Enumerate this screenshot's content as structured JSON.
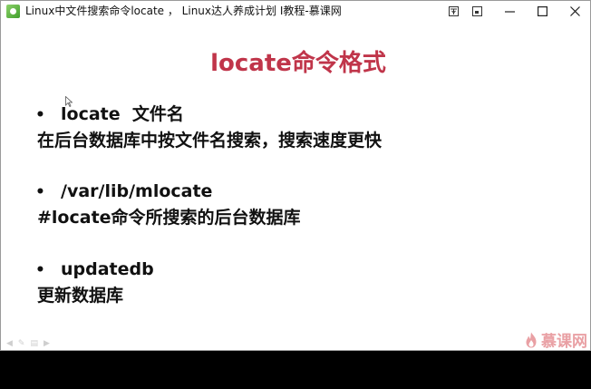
{
  "window": {
    "title": "Linux中文件搜索命令locate ， Linux达人养成计划 I教程-慕课网",
    "app_icon": "imooc-app-icon"
  },
  "titlebar_buttons": {
    "pin": "pin-icon",
    "restore_small": "restore-small-icon",
    "minimize": "minimize-icon",
    "maximize": "maximize-icon",
    "close": "close-icon"
  },
  "slide": {
    "title": "locate命令格式",
    "title_color": "#c0354a",
    "sections": [
      {
        "bullet": "•",
        "command": "locate  文件名",
        "description": "在后台数据库中按文件名搜索，搜索速度更快"
      },
      {
        "bullet": "•",
        "command": "/var/lib/mlocate",
        "description": "#locate命令所搜索的后台数据库"
      },
      {
        "bullet": "•",
        "command": "updatedb",
        "description": "更新数据库"
      }
    ]
  },
  "watermark": {
    "text": "慕课网",
    "icon": "flame-icon",
    "color": "#e9a0a4"
  }
}
